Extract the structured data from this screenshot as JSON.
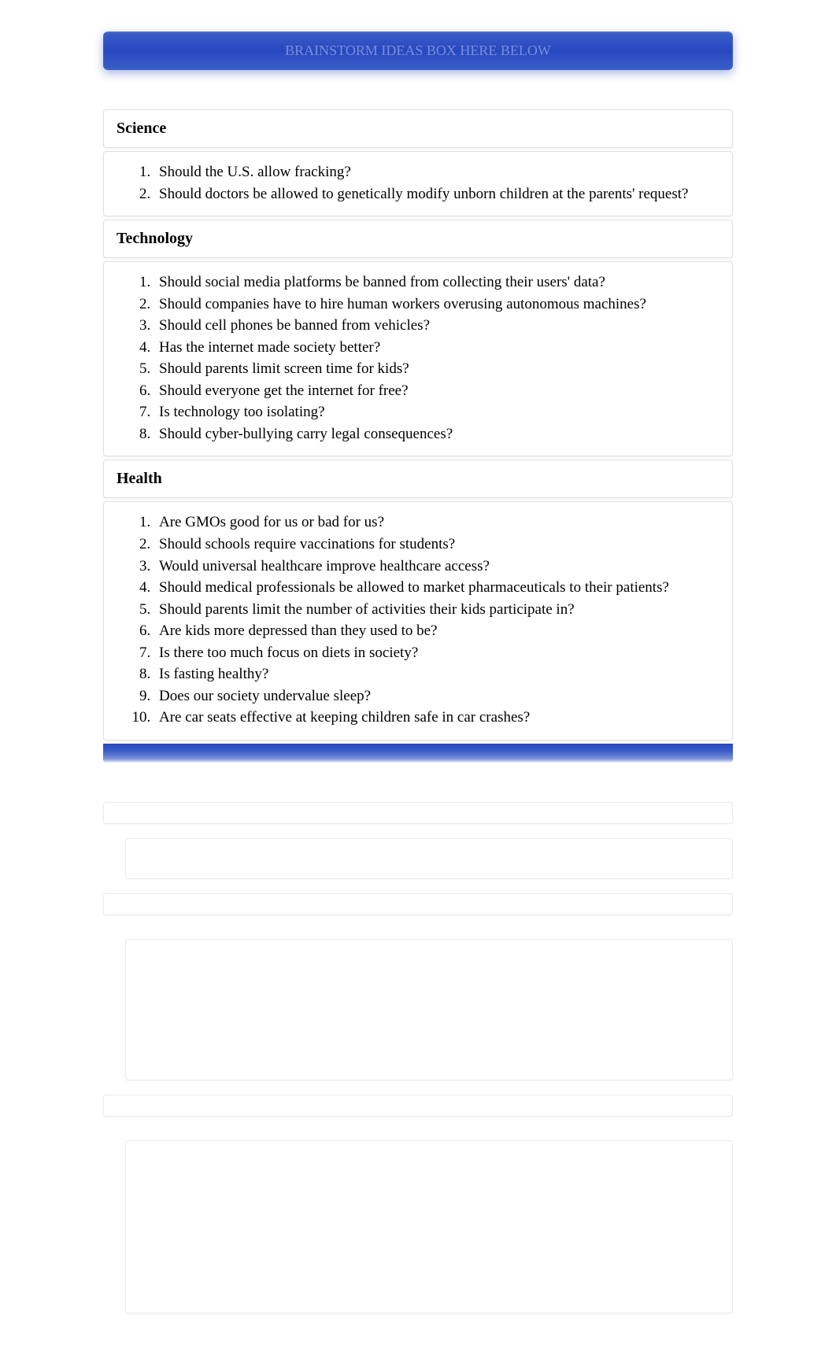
{
  "banner": {
    "text": "BRAINSTORM IDEAS BOX HERE BELOW"
  },
  "sections": [
    {
      "title": "Science",
      "items": [
        "Should the U.S. allow fracking?",
        "Should doctors be allowed to genetically modify unborn children at the parents' request?"
      ]
    },
    {
      "title": "Technology",
      "items": [
        "Should social media platforms be banned from collecting their users' data?",
        "Should companies have to hire human workers overusing autonomous machines?",
        "Should cell phones be banned from vehicles?",
        "Has the internet made society better?",
        "Should parents limit screen time for kids?",
        "Should everyone get the internet for free?",
        "Is technology too isolating?",
        "Should cyber-bullying carry legal consequences?"
      ]
    },
    {
      "title": "Health",
      "items": [
        "Are GMOs good for us or bad for us?",
        "Should schools require vaccinations for students?",
        "Would universal healthcare improve healthcare access?",
        "Should medical professionals be allowed to market pharmaceuticals to their patients?",
        "Should parents limit the number of activities their kids participate in?",
        "Are kids more depressed than they used to be?",
        "Is there too much focus on diets in society?",
        "Is fasting healthy?",
        "Does our society undervalue sleep?",
        "Are car seats effective at keeping children safe in car crashes?"
      ]
    }
  ]
}
